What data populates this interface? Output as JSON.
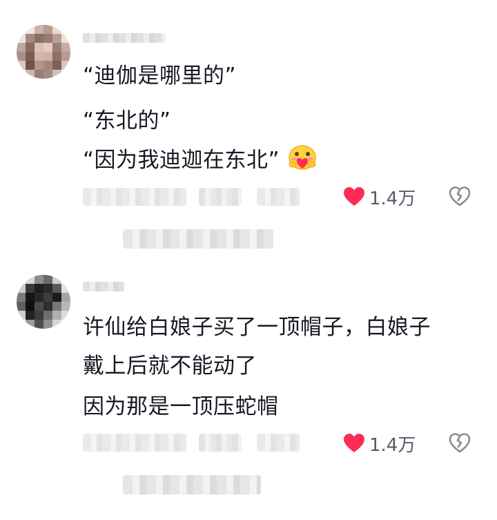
{
  "comments": [
    {
      "lines": [
        "“迪伽是哪里的”",
        "“东北的”",
        "“因为我迪迦在东北”"
      ],
      "emoji": "blushing-heart-emoji",
      "likes": "1.4万"
    },
    {
      "lines": [
        "许仙给白娘子买了一顶帽子，白娘子",
        "戴上后就不能动了",
        "因为那是一顶压蛇帽"
      ],
      "likes": "1.4万"
    }
  ],
  "colors": {
    "text": "#161823",
    "like_heart": "#fe2c55",
    "like_count": "#555a66",
    "dislike_icon": "#8a8b91"
  },
  "icons": {
    "like": "heart-icon",
    "dislike": "broken-heart-icon"
  }
}
